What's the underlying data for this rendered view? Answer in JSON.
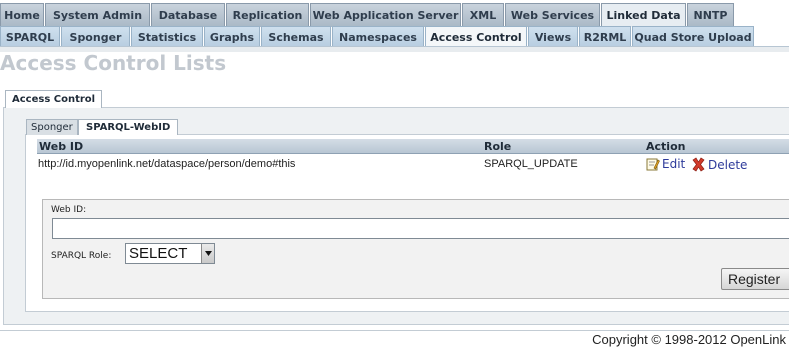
{
  "top_tabs": [
    {
      "label": "Home",
      "active": false
    },
    {
      "label": "System Admin",
      "active": false
    },
    {
      "label": "Database",
      "active": false
    },
    {
      "label": "Replication",
      "active": false
    },
    {
      "label": "Web Application Server",
      "active": false
    },
    {
      "label": "XML",
      "active": false
    },
    {
      "label": "Web Services",
      "active": false
    },
    {
      "label": "Linked Data",
      "active": true
    },
    {
      "label": "NNTP",
      "active": false
    }
  ],
  "sub_tabs": [
    {
      "label": "SPARQL",
      "active": false
    },
    {
      "label": "Sponger",
      "active": false
    },
    {
      "label": "Statistics",
      "active": false
    },
    {
      "label": "Graphs",
      "active": false
    },
    {
      "label": "Schemas",
      "active": false
    },
    {
      "label": "Namespaces",
      "active": false
    },
    {
      "label": "Access Control",
      "active": true
    },
    {
      "label": "Views",
      "active": false
    },
    {
      "label": "R2RML",
      "active": false
    },
    {
      "label": "Quad Store Upload",
      "active": false
    }
  ],
  "page_title": "Access Control Lists",
  "panel_tab": "Access Control",
  "section_tabs": {
    "sponger": "Sponger",
    "sparql_webid": "SPARQL-WebID"
  },
  "table": {
    "headers": {
      "webid": "Web ID",
      "role": "Role",
      "action": "Action"
    },
    "rows": [
      {
        "webid": "http://id.myopenlink.net/dataspace/person/demo#this",
        "role": "SPARQL_UPDATE",
        "edit": "Edit",
        "delete": "Delete"
      }
    ]
  },
  "form": {
    "webid_label": "Web ID:",
    "webid_value": "",
    "role_label": "SPARQL Role:",
    "role_selected": "SELECT",
    "register_label": "Register"
  },
  "footer": {
    "copyright": "Copyright © 1998-2012 OpenLink"
  },
  "colors": {
    "link": "#2d3a9a",
    "title": "#c2c8cf",
    "delete_icon": "#d23b2b"
  }
}
